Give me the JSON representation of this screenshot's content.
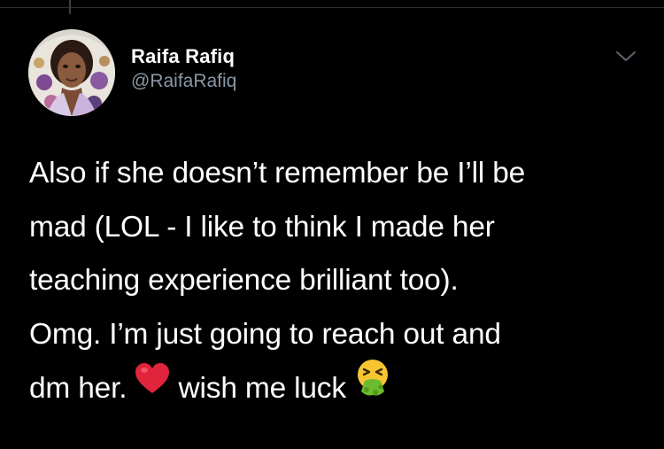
{
  "tweet": {
    "author": {
      "display_name": "Raifa Rafiq",
      "handle": "@RaifaRafiq",
      "avatar_icon": "profile-photo"
    },
    "menu_icon": "chevron-down-icon",
    "body_lines": [
      "Also if she doesn’t remember be I’ll be",
      "mad (LOL - I like to think I made her",
      "teaching experience brilliant too).",
      "Omg. I’m just going to reach out and"
    ],
    "last_line": {
      "before_emoji": "dm her. ",
      "emoji_1": "red-heart-emoji",
      "after_emoji": " wish me luck ",
      "emoji_2": "vomiting-face-emoji"
    }
  },
  "colors": {
    "background": "#000000",
    "text": "#ffffff",
    "secondary_text": "#8b98a5",
    "heart": "#e0243b",
    "vomit_face": "#f7c531",
    "vomit": "#6cbd2e"
  }
}
